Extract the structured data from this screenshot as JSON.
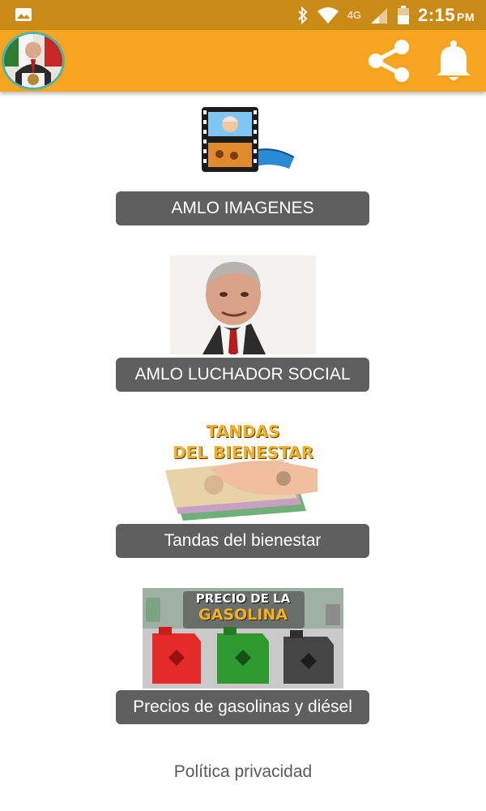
{
  "status_bar": {
    "network": "4G",
    "time": "2:15",
    "ampm": "PM"
  },
  "app_bar": {
    "avatar_icon": "president-avatar-icon",
    "share_icon": "share-icon",
    "bell_icon": "notification-bell-icon"
  },
  "menu": [
    {
      "label": "AMLO IMAGENES",
      "image": "film-strip-photo-icon"
    },
    {
      "label": "AMLO LUCHADOR SOCIAL",
      "image": "caricature-portrait-image"
    },
    {
      "label": "Tandas del bienestar",
      "image_text_1": "TANDAS",
      "image_text_2": "DEL BIENESTAR"
    },
    {
      "label": "Precios de gasolinas y diésel",
      "image_text_1": "PRECIO DE LA",
      "image_text_2": "GASOLINA"
    }
  ],
  "footer": {
    "privacy_label": "Política privacidad"
  },
  "colors": {
    "status_bar": "#c98a16",
    "app_bar": "#f7a520",
    "button": "#5f5f5f",
    "avatar_ring": "#4fb3a7"
  }
}
